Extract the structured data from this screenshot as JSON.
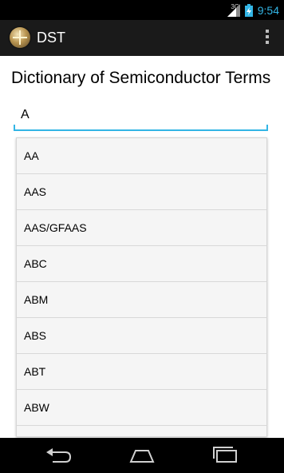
{
  "status_bar": {
    "network_type": "3G",
    "time": "9:54"
  },
  "action_bar": {
    "title": "DST"
  },
  "main": {
    "heading": "Dictionary of Semiconductor Terms",
    "search": {
      "value": "A",
      "placeholder": ""
    },
    "suggestions": [
      "AA",
      "AAS",
      "AAS/GFAAS",
      "ABC",
      "ABM",
      "ABS",
      "ABT",
      "ABW"
    ]
  },
  "colors": {
    "accent": "#33b5e5",
    "status_bar_bg": "#000000",
    "action_bar_bg": "#1a1a1a",
    "dropdown_bg": "#f5f5f5"
  },
  "icons": {
    "app": "app-logo-icon",
    "overflow": "overflow-menu-icon",
    "signal": "signal-strength-icon",
    "battery": "battery-charging-icon",
    "back": "back-icon",
    "home": "home-icon",
    "recents": "recent-apps-icon"
  }
}
